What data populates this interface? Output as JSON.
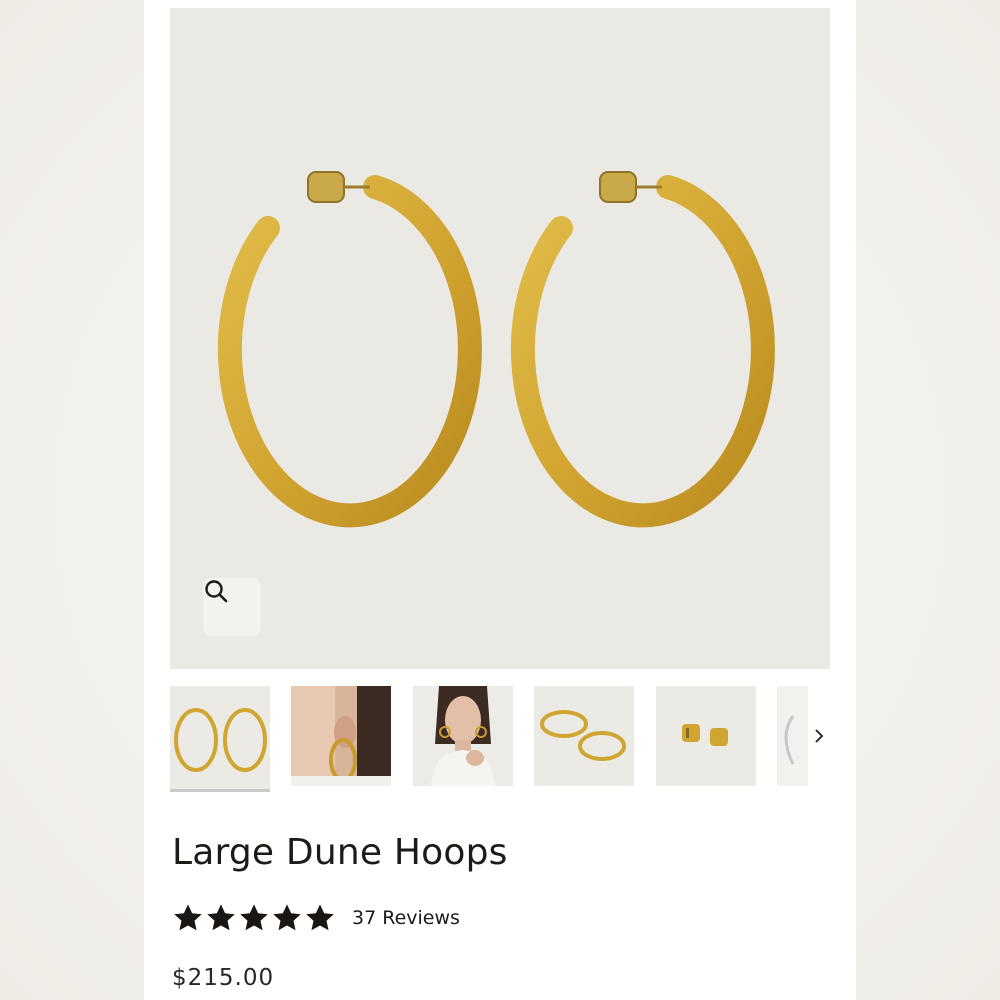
{
  "product": {
    "title": "Large Dune Hoops",
    "rating": 5,
    "reviews_label": "37 Reviews",
    "price": "$215.00"
  },
  "gallery": {
    "zoom_icon": "search-icon",
    "thumbnails": [
      {
        "name": "thumb-hoops-front",
        "active": true
      },
      {
        "name": "thumb-ear-model",
        "active": false
      },
      {
        "name": "thumb-portrait-model",
        "active": false
      },
      {
        "name": "thumb-hoops-flat",
        "active": false
      },
      {
        "name": "thumb-earring-backs",
        "active": false
      },
      {
        "name": "thumb-partial",
        "active": false
      }
    ],
    "next_icon": "chevron-right-icon"
  },
  "colors": {
    "gold": "#d2a630",
    "gold_dark": "#b88a1e",
    "star": "#1a1614",
    "image_bg": "#eae9e4"
  }
}
